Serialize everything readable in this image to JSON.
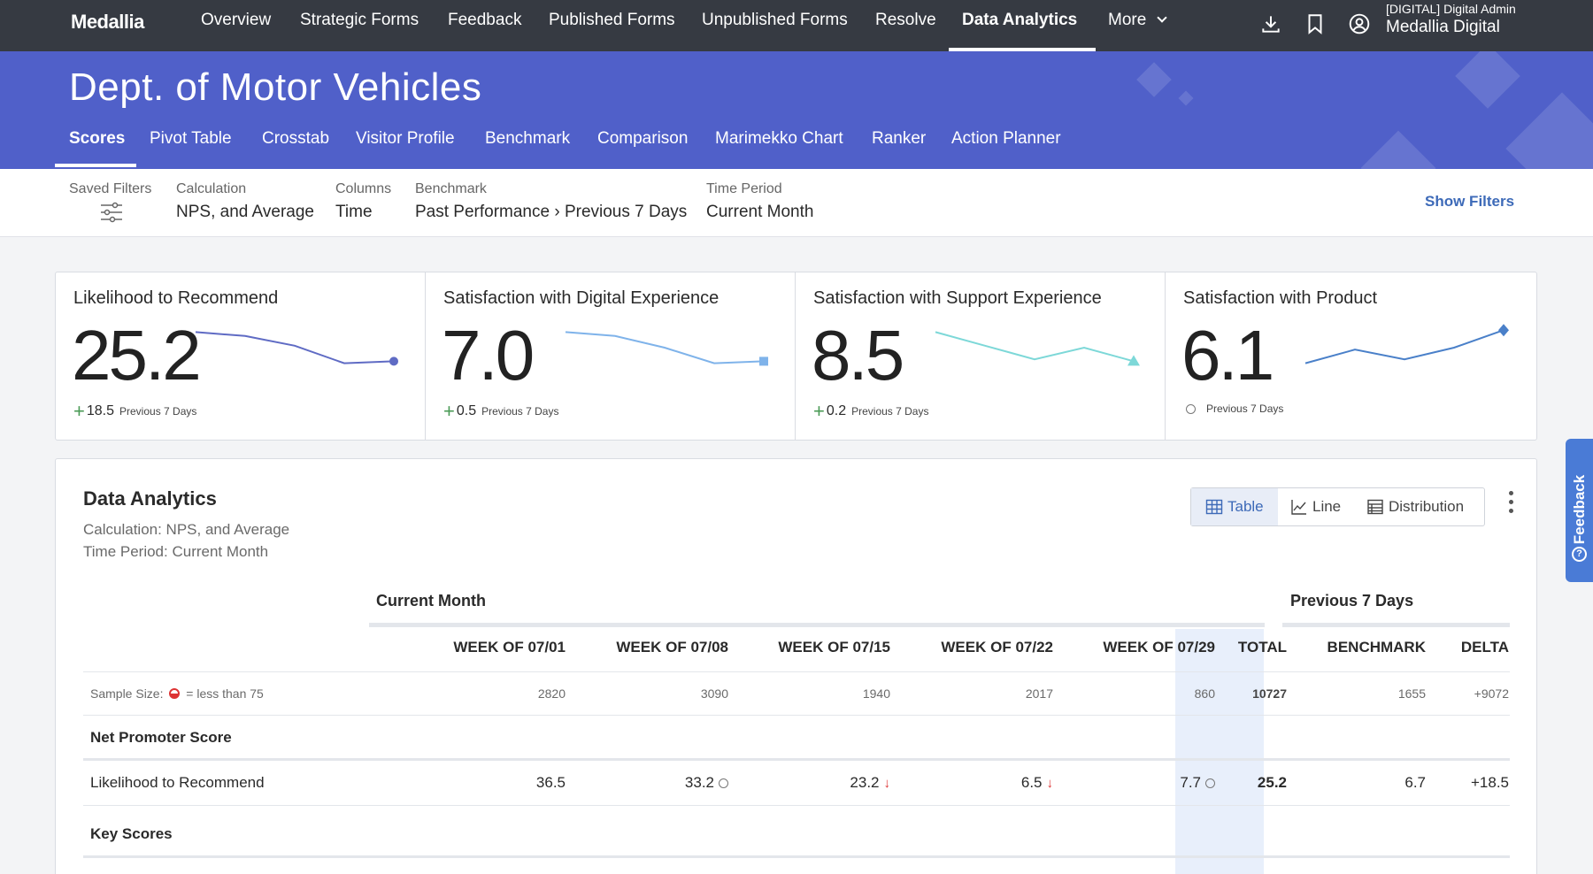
{
  "topnav": {
    "logo": "Medallia",
    "items": [
      "Overview",
      "Strategic Forms",
      "Feedback",
      "Published Forms",
      "Unpublished Forms",
      "Resolve",
      "Data Analytics",
      "More"
    ],
    "active": "Data Analytics",
    "user_role": "[DIGITAL] Digital Admin",
    "user_name": "Medallia Digital",
    "icons": [
      "download-icon",
      "bookmark-icon",
      "user-circle-icon"
    ]
  },
  "banner": {
    "title": "Dept. of Motor Vehicles",
    "tabs": [
      "Scores",
      "Pivot Table",
      "Crosstab",
      "Visitor Profile",
      "Benchmark",
      "Comparison",
      "Marimekko Chart",
      "Ranker",
      "Action Planner"
    ],
    "active_tab": "Scores"
  },
  "filters": {
    "saved_filters_label": "Saved Filters",
    "calc_label": "Calculation",
    "calc_value": "NPS, and Average",
    "columns_label": "Columns",
    "columns_value": "Time",
    "benchmark_label": "Benchmark",
    "benchmark_value": "Past Performance › Previous 7 Days",
    "period_label": "Time Period",
    "period_value": "Current Month",
    "show_filters": "Show Filters"
  },
  "cards": [
    {
      "title": "Likelihood to Recommend",
      "score": "25.2",
      "delta": "18.5",
      "delta_label": "Previous 7 Days",
      "color": "#5f6bc4",
      "marker": "circle",
      "trend": [
        0.9,
        0.8,
        0.55,
        0.1,
        0.15
      ]
    },
    {
      "title": "Satisfaction with Digital Experience",
      "score": "7.0",
      "delta": "0.5",
      "delta_label": "Previous 7 Days",
      "color": "#7fb3ea",
      "marker": "square",
      "trend": [
        0.9,
        0.8,
        0.5,
        0.1,
        0.15
      ]
    },
    {
      "title": "Satisfaction with Support Experience",
      "score": "8.5",
      "delta": "0.2",
      "delta_label": "Previous 7 Days",
      "color": "#7dd8d8",
      "marker": "triangle",
      "trend": [
        0.9,
        0.55,
        0.2,
        0.5,
        0.15
      ]
    },
    {
      "title": "Satisfaction with Product",
      "score": "6.1",
      "delta": "",
      "delta_label": "Previous 7 Days",
      "color": "#4a80c9",
      "marker": "diamond",
      "trend": [
        0.1,
        0.45,
        0.2,
        0.5,
        0.95
      ]
    }
  ],
  "panel": {
    "title": "Data Analytics",
    "calc": "Calculation: NPS, and Average",
    "period": "Time Period: Current Month",
    "views": [
      "Table",
      "Line",
      "Distribution"
    ],
    "active_view": "Table",
    "group_current": "Current Month",
    "group_prev": "Previous 7 Days",
    "columns": [
      "WEEK OF 07/01",
      "WEEK OF 07/08",
      "WEEK OF 07/15",
      "WEEK OF 07/22",
      "WEEK OF 07/29",
      "TOTAL",
      "BENCHMARK",
      "DELTA"
    ],
    "sample_label_a": "Sample Size:",
    "sample_label_b": "= less than 75",
    "sample": [
      "2820",
      "3090",
      "1940",
      "2017",
      "860",
      "10727",
      "1655",
      "+9072"
    ],
    "section_nps": "Net Promoter Score",
    "ltr_label": "Likelihood to Recommend",
    "ltr": [
      "36.5",
      "33.2",
      "23.2",
      "6.5",
      "7.7",
      "25.2",
      "6.7",
      "+18.5"
    ],
    "ltr_marks": [
      "",
      "circle",
      "down",
      "down",
      "circle"
    ],
    "section_key": "Key Scores"
  },
  "feedback_tab": "Feedback"
}
